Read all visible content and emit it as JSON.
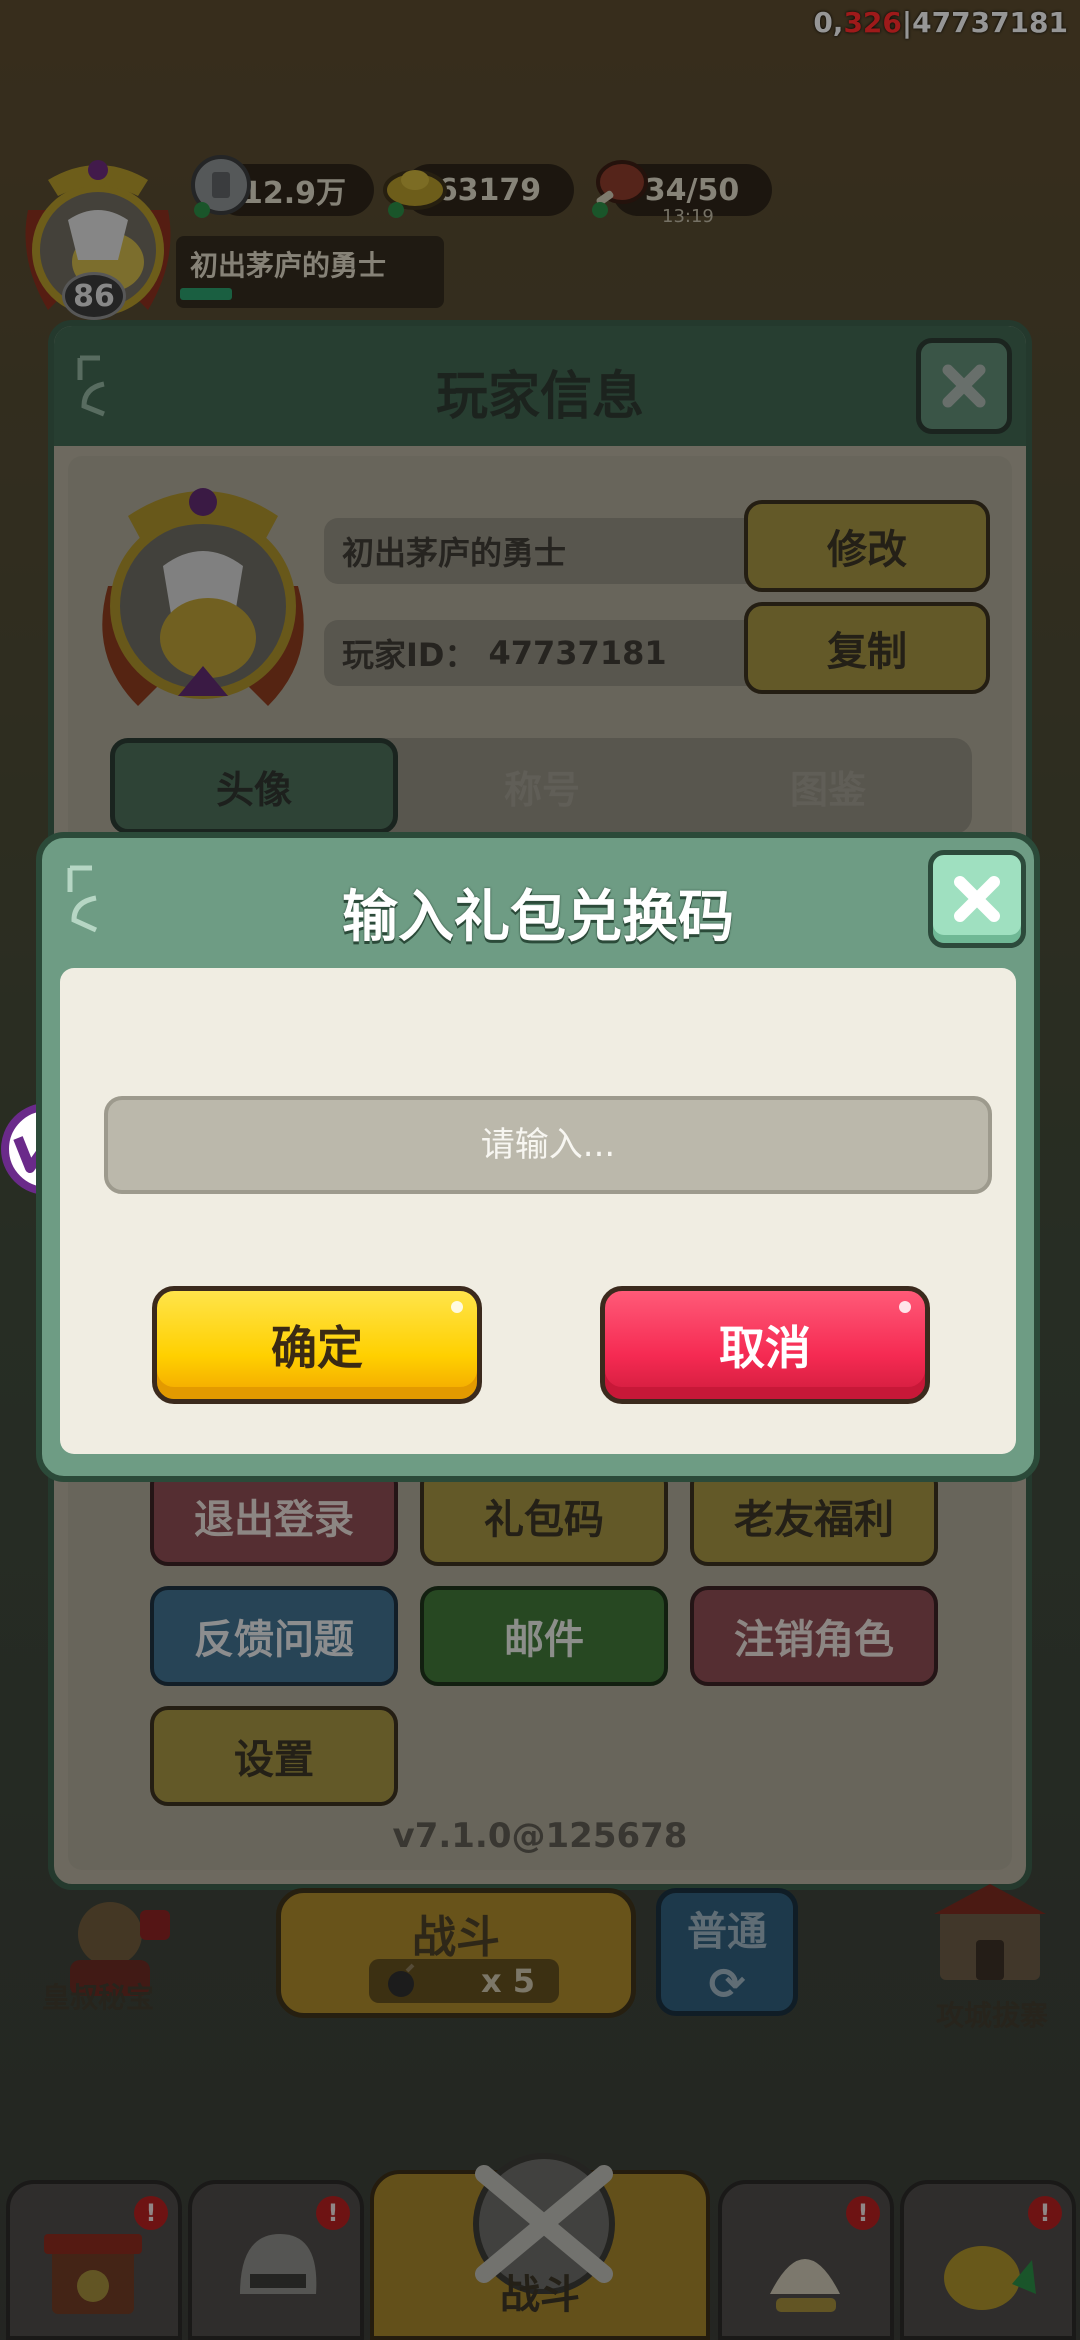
{
  "debug": {
    "prefix": "0,",
    "highlight": "326",
    "suffix": "|47737181"
  },
  "hud": {
    "level": "86",
    "silver": "12.9万",
    "gold": "63179",
    "stamina": "34/50",
    "stamina_timer": "13:19",
    "title": "初出茅庐的勇士",
    "exp_fraction": 0.2
  },
  "player_panel": {
    "title": "玩家信息",
    "nickname": "初出茅庐的勇士",
    "player_id_label": "玩家ID：",
    "player_id": "47737181",
    "modify_label": "修改",
    "copy_label": "复制",
    "tabs": [
      {
        "label": "头像",
        "active": true
      },
      {
        "label": "称号",
        "active": false
      },
      {
        "label": "图鉴",
        "active": false
      }
    ],
    "actions": {
      "logout": "退出登录",
      "gift_code": "礼包码",
      "old_friend": "老友福利",
      "feedback": "反馈问题",
      "mail": "邮件",
      "delete_role": "注销角色",
      "settings": "设置"
    },
    "version": "v7.1.0@125678"
  },
  "bottom": {
    "battle_label": "战斗",
    "battle_cost": "x 5",
    "mode_label": "普通",
    "left_label": "皇叔秘宝",
    "right_label": "攻城拔寨",
    "nav_center_label": "战斗",
    "badge": "!"
  },
  "modal": {
    "title": "输入礼包兑换码",
    "input_placeholder": "请输入...",
    "input_value": "",
    "confirm_label": "确定",
    "cancel_label": "取消"
  },
  "colors": {
    "modal_frame": "#6e9c84",
    "confirm": "#ffd000",
    "cancel": "#f52a52"
  }
}
